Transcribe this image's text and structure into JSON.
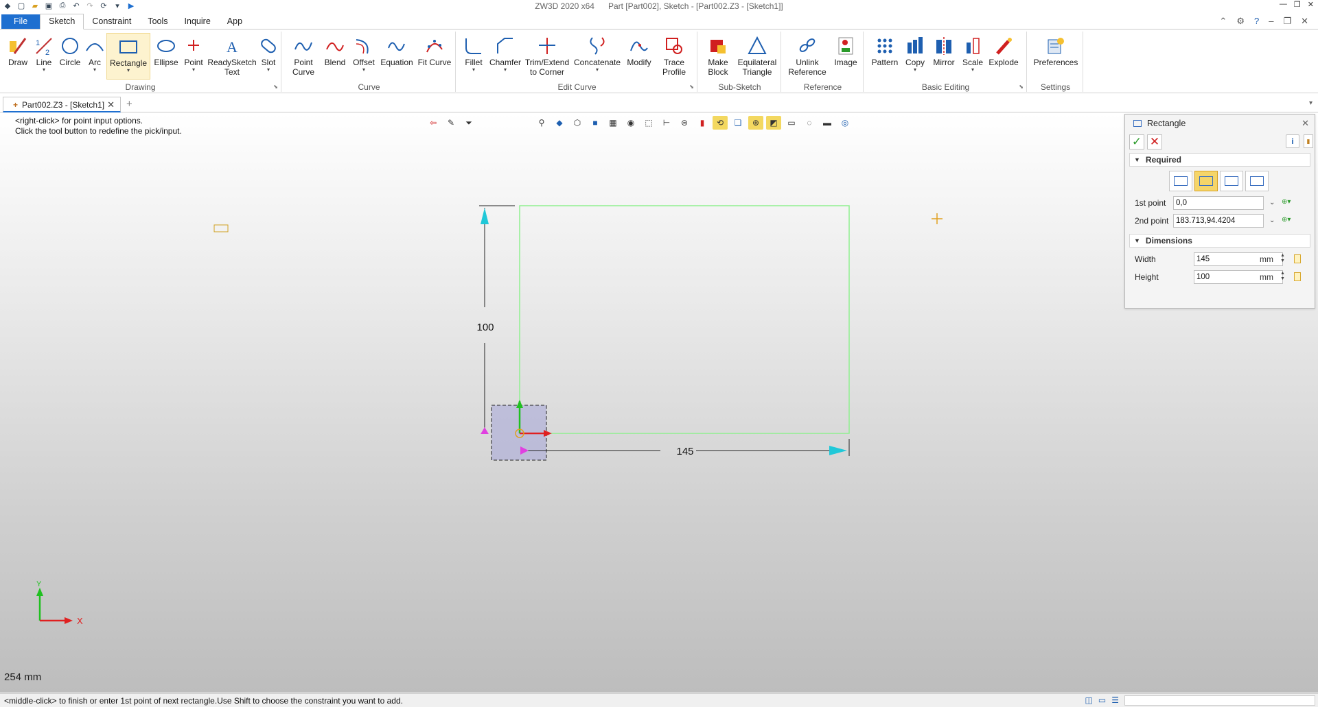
{
  "window": {
    "app": "ZW3D 2020 x64",
    "doc": "Part [Part002],  Sketch - [Part002.Z3 - [Sketch1]]"
  },
  "menu": {
    "tabs": [
      "File",
      "Sketch",
      "Constraint",
      "Tools",
      "Inquire",
      "App"
    ],
    "active": "Sketch"
  },
  "ribbon": {
    "groups": {
      "drawing": "Drawing",
      "curve": "Curve",
      "edit_curve": "Edit Curve",
      "sub_sketch": "Sub-Sketch",
      "reference": "Reference",
      "basic_editing": "Basic Editing",
      "settings": "Settings"
    },
    "tools": {
      "draw": "Draw",
      "line": "Line",
      "circle": "Circle",
      "arc": "Arc",
      "rectangle": "Rectangle",
      "ellipse": "Ellipse",
      "point": "Point",
      "readysketch": "ReadySketch",
      "readysketch2": "Text",
      "slot": "Slot",
      "point_curve": "Point",
      "point_curve2": "Curve",
      "blend": "Blend",
      "offset": "Offset",
      "equation": "Equation",
      "fit_curve": "Fit Curve",
      "fillet": "Fillet",
      "chamfer": "Chamfer",
      "trim": "Trim/Extend",
      "trim2": "to Corner",
      "concatenate": "Concatenate",
      "modify": "Modify",
      "trace": "Trace",
      "trace2": "Profile",
      "make_block": "Make",
      "make_block2": "Block",
      "eq_triangle": "Equilateral",
      "eq_triangle2": "Triangle",
      "unlink": "Unlink",
      "unlink2": "Reference",
      "image": "Image",
      "pattern": "Pattern",
      "copy": "Copy",
      "mirror": "Mirror",
      "scale": "Scale",
      "explode": "Explode",
      "preferences": "Preferences"
    }
  },
  "doc_tab": {
    "label": "Part002.Z3 - [Sketch1]"
  },
  "viewport": {
    "hint_line1": "<right-click> for point input options.",
    "hint_line2": "Click the tool button to redefine the pick/input.",
    "scale_label": "254 mm",
    "dim_height": "100",
    "dim_width": "145",
    "axis_x": "X",
    "axis_y": "Y"
  },
  "panel": {
    "title": "Rectangle",
    "required_label": "Required",
    "first_point_label": "1st point",
    "first_point_value": "0,0",
    "second_point_label": "2nd point",
    "second_point_value": "183.713,94.4204",
    "dimensions_label": "Dimensions",
    "width_label": "Width",
    "width_value": "145",
    "height_label": "Height",
    "height_value": "100",
    "unit": "mm"
  },
  "status": {
    "message": "<middle-click> to finish or enter 1st point of next rectangle.Use Shift to choose the constraint you want to add."
  },
  "colors": {
    "file_tab": "#1e6fd0",
    "rectangle_preview": "#90f090",
    "dimension_arrow": "#20c8d8",
    "selected_tool": "#fdf3cf"
  }
}
